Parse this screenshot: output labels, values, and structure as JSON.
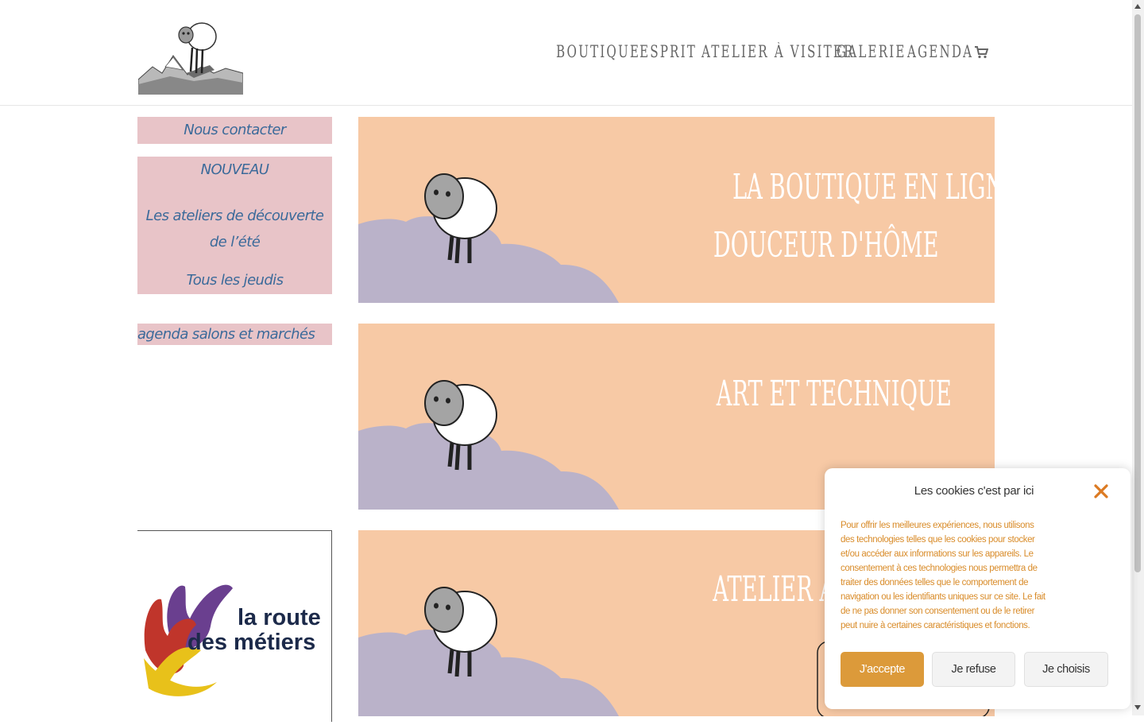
{
  "header": {
    "logo_icon": "sheep-on-mountain-logo",
    "nav": [
      {
        "label": "Boutique"
      },
      {
        "label": "Esprit"
      },
      {
        "label": "Atelier à visiter"
      },
      {
        "label": "Galerie"
      },
      {
        "label": "Agenda"
      }
    ],
    "cart_icon": "shopping-cart-icon"
  },
  "sidebar": {
    "contact_label": "Nous contacter",
    "nouveau": {
      "title": "NOUVEAU",
      "line1": "Les ateliers de découverte de l’été",
      "line2": "Tous les jeudis"
    },
    "agenda_label": "agenda salons et marchés",
    "route_logo": {
      "line1": "la route",
      "line2": "des métiers"
    }
  },
  "banners": [
    {
      "line1": "La boutique en ligne",
      "line2": "douceur d'hôme"
    },
    {
      "line1": "Art et technique",
      "line2": ""
    },
    {
      "line1": "Atelier à visiter",
      "line2": ""
    }
  ],
  "cookie": {
    "title": "Les cookies c'est par ici",
    "text": "Pour offrir les meilleures expériences, nous utilisons des technologies telles que les cookies pour stocker et/ou accéder aux informations sur les appareils. Le consentement à ces technologies nous permettra de traiter des données telles que le comportement de navigation ou les identifiants uniques sur ce site. Le fait de ne pas donner son consentement ou de le retirer peut nuire à certaines caractéristiques et fonctions.",
    "accept_label": "J'accepte",
    "refuse_label": "Je refuse",
    "choose_label": "Je choisis",
    "close_icon": "close-icon"
  },
  "colors": {
    "banner_bg": "#f7c9a5",
    "cloud": "#bab2c9",
    "sidebar_bg": "#e8c4c8",
    "sidebar_text": "#3b6a9a",
    "cookie_accent": "#dc9a3a"
  }
}
